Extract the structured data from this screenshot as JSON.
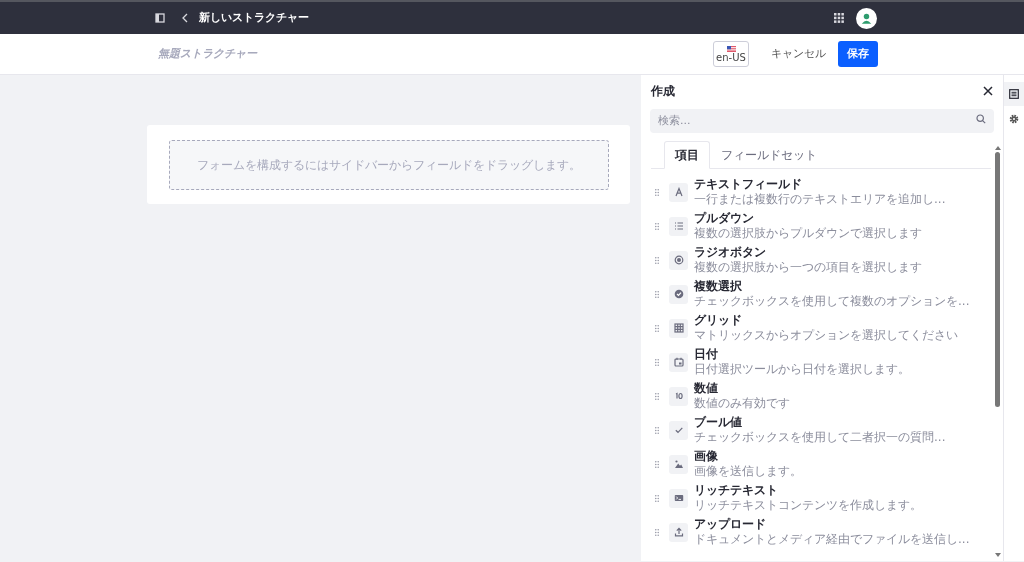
{
  "topbar": {
    "title": "新しいストラクチャー"
  },
  "header": {
    "structure_name_placeholder": "無題ストラクチャー",
    "locale": "en-US",
    "cancel": "キャンセル",
    "save": "保存"
  },
  "canvas": {
    "drop_hint": "フォームを構成するにはサイドバーからフィールドをドラッグします。"
  },
  "sidebar": {
    "title": "作成",
    "search": {
      "placeholder": "検索..."
    },
    "tabs": [
      {
        "label": "項目",
        "selected": true
      },
      {
        "label": "フィールドセット",
        "selected": false
      }
    ],
    "items": [
      {
        "kind": "text",
        "label": "テキストフィールド",
        "description": "一行または複数行のテキストエリアを追加し..."
      },
      {
        "kind": "list",
        "label": "プルダウン",
        "description": "複数の選択肢からプルダウンで選択します"
      },
      {
        "kind": "radio",
        "label": "ラジオボタン",
        "description": "複数の選択肢から一つの項目を選択します"
      },
      {
        "kind": "multi",
        "label": "複数選択",
        "description": "チェックボックスを使用して複数のオプションを..."
      },
      {
        "kind": "grid",
        "label": "グリッド",
        "description": "マトリックスからオプションを選択してください"
      },
      {
        "kind": "date",
        "label": "日付",
        "description": "日付選択ツールから日付を選択します。"
      },
      {
        "kind": "number",
        "label": "数値",
        "description": "数値のみ有効です"
      },
      {
        "kind": "boolean",
        "label": "ブール値",
        "description": "チェックボックスを使用して二者択一の質問..."
      },
      {
        "kind": "image",
        "label": "画像",
        "description": "画像を送信します。"
      },
      {
        "kind": "rich",
        "label": "リッチテキスト",
        "description": "リッチテキストコンテンツを作成します。"
      },
      {
        "kind": "upload",
        "label": "アップロード",
        "description": "ドキュメントとメディア経由でファイルを送信し..."
      }
    ]
  }
}
